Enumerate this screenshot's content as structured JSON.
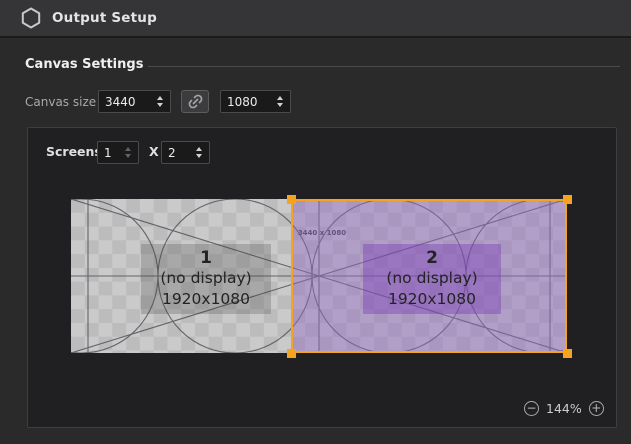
{
  "titlebar": {
    "title": "Output Setup"
  },
  "canvas_settings": {
    "section_title": "Canvas Settings",
    "size_label": "Canvas size",
    "width_value": "3440",
    "height_value": "1080"
  },
  "screens_panel": {
    "screens_label": "Screens",
    "grid_cols": "1",
    "grid_separator": "X",
    "grid_rows": "2"
  },
  "preview": {
    "canvas_resolution": "3440 x 1080",
    "screens": [
      {
        "number": "1",
        "status": "(no display)",
        "resolution": "1920x1080",
        "selected": false
      },
      {
        "number": "2",
        "status": "(no display)",
        "resolution": "1920x1080",
        "selected": true
      }
    ]
  },
  "zoom_controls": {
    "zoom_out": "−",
    "level": "144%",
    "zoom_in": "+"
  },
  "colors": {
    "accent": "#f5a422",
    "selection_tint": "#946ac6"
  }
}
